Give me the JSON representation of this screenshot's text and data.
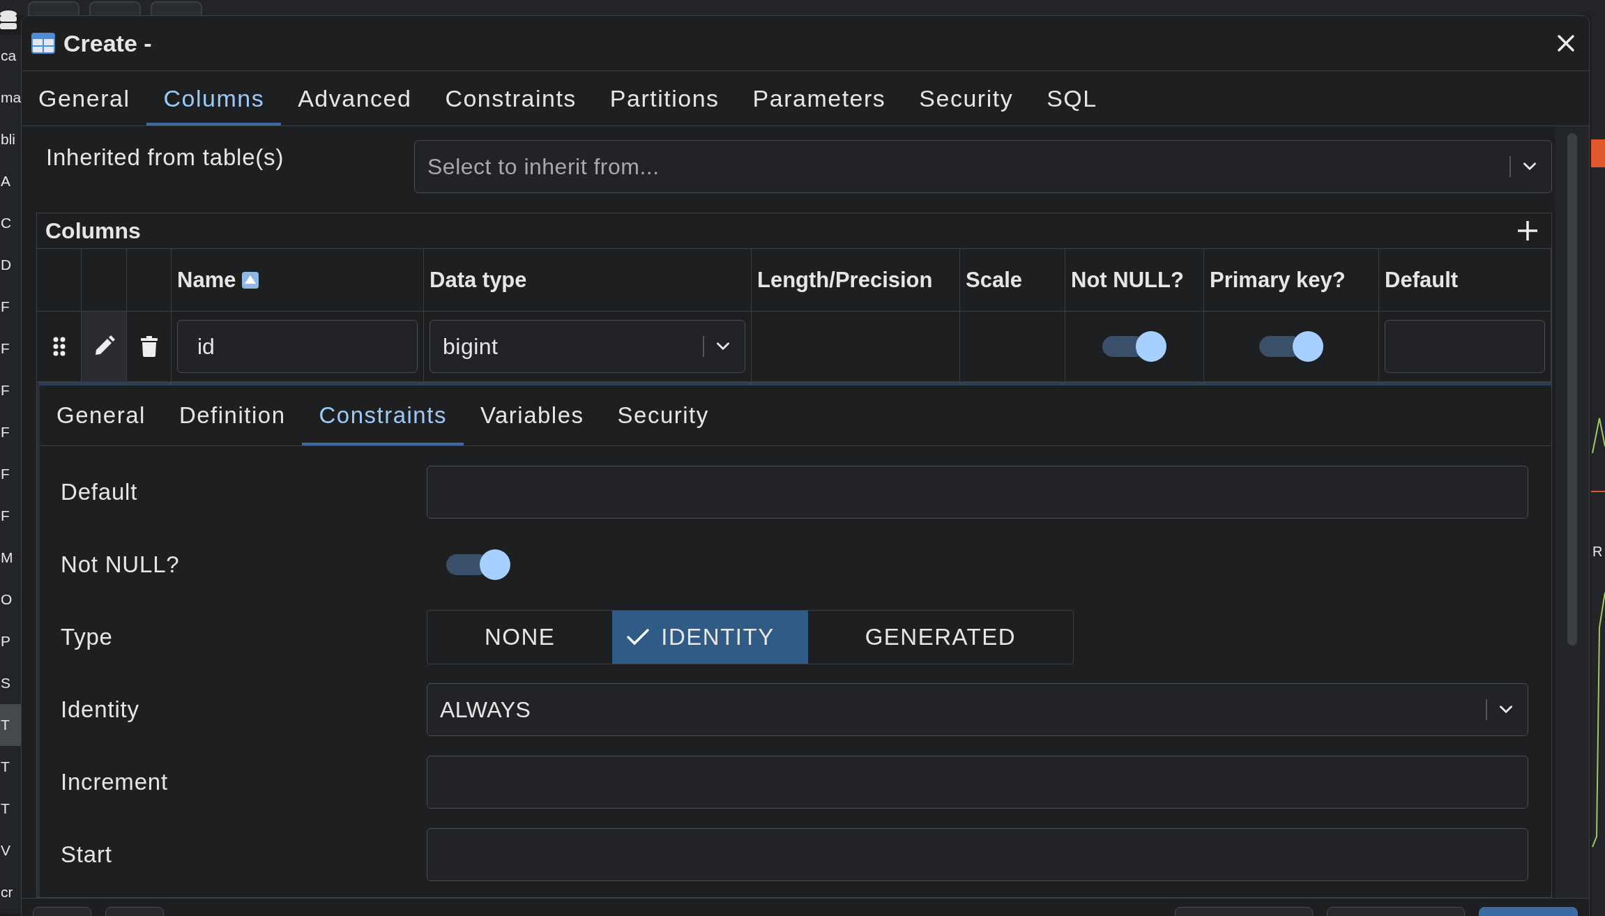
{
  "background_app": {
    "sidebar_items": [
      {
        "label": "ca",
        "selected": false
      },
      {
        "label": "ma",
        "selected": false
      },
      {
        "label": "bli",
        "selected": false
      },
      {
        "label": "A",
        "selected": false
      },
      {
        "label": "C",
        "selected": false
      },
      {
        "label": "D",
        "selected": false
      },
      {
        "label": "F",
        "selected": false
      },
      {
        "label": "F",
        "selected": false
      },
      {
        "label": "F",
        "selected": false
      },
      {
        "label": "F",
        "selected": false
      },
      {
        "label": "F",
        "selected": false
      },
      {
        "label": "F",
        "selected": false
      },
      {
        "label": "M",
        "selected": false
      },
      {
        "label": "O",
        "selected": false
      },
      {
        "label": "P",
        "selected": false
      },
      {
        "label": "S",
        "selected": false
      },
      {
        "label": "T",
        "selected": true
      },
      {
        "label": "T",
        "selected": false
      },
      {
        "label": "T",
        "selected": false
      },
      {
        "label": "V",
        "selected": false
      },
      {
        "label": "cr",
        "selected": false
      }
    ],
    "side_label": "R"
  },
  "dialog": {
    "title": "Create -",
    "tabs": [
      {
        "label": "General",
        "selected": false
      },
      {
        "label": "Columns",
        "selected": true
      },
      {
        "label": "Advanced",
        "selected": false
      },
      {
        "label": "Constraints",
        "selected": false
      },
      {
        "label": "Partitions",
        "selected": false
      },
      {
        "label": "Parameters",
        "selected": false
      },
      {
        "label": "Security",
        "selected": false
      },
      {
        "label": "SQL",
        "selected": false
      }
    ],
    "inherit": {
      "label": "Inherited from table(s)",
      "placeholder": "Select to inherit from..."
    },
    "columns_panel": {
      "title": "Columns",
      "headers": [
        {
          "label": "Name",
          "sorted": true
        },
        {
          "label": "Data type",
          "sorted": false
        },
        {
          "label": "Length/Precision",
          "sorted": false
        },
        {
          "label": "Scale",
          "sorted": false
        },
        {
          "label": "Not NULL?",
          "sorted": false
        },
        {
          "label": "Primary key?",
          "sorted": false
        },
        {
          "label": "Default",
          "sorted": false
        }
      ],
      "rows": [
        {
          "name": "id",
          "data_type": "bigint",
          "not_null": true,
          "primary_key": true,
          "expanded": true
        }
      ]
    },
    "detail": {
      "tabs": [
        {
          "label": "General",
          "selected": false
        },
        {
          "label": "Definition",
          "selected": false
        },
        {
          "label": "Constraints",
          "selected": true
        },
        {
          "label": "Variables",
          "selected": false
        },
        {
          "label": "Security",
          "selected": false
        }
      ],
      "fields": [
        {
          "kind": "text",
          "label": "Default"
        },
        {
          "kind": "toggle",
          "label": "Not NULL?",
          "on": true
        },
        {
          "kind": "segmented",
          "label": "Type",
          "options": [
            {
              "label": "NONE",
              "selected": false
            },
            {
              "label": "IDENTITY",
              "selected": true
            },
            {
              "label": "GENERATED",
              "selected": false
            }
          ]
        },
        {
          "kind": "select",
          "label": "Identity",
          "value": "ALWAYS"
        },
        {
          "kind": "text",
          "label": "Increment"
        },
        {
          "kind": "text",
          "label": "Start"
        }
      ]
    }
  }
}
